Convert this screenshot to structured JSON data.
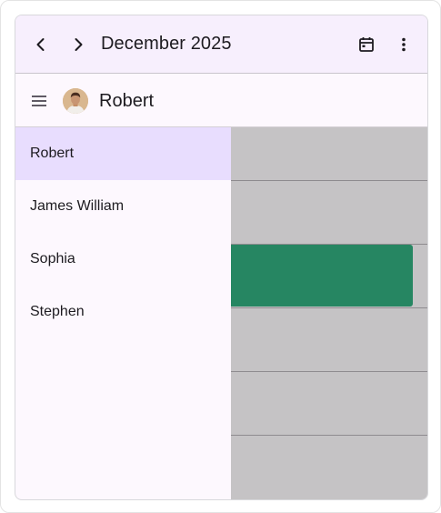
{
  "header": {
    "title": "December 2025",
    "prev_icon": "chevron-left-icon",
    "next_icon": "chevron-right-icon",
    "calendar_icon": "calendar-icon",
    "more_icon": "more-vert-icon"
  },
  "resource_bar": {
    "menu_icon": "menu-icon",
    "selected_resource": "Robert"
  },
  "drawer": {
    "items": [
      {
        "label": "Robert",
        "selected": true
      },
      {
        "label": "James William",
        "selected": false
      },
      {
        "label": "Sophia",
        "selected": false
      },
      {
        "label": "Stephen",
        "selected": false
      }
    ]
  },
  "colors": {
    "header_bg": "#f7effd",
    "selected_item_bg": "#e8ddfe",
    "appointment": "#268662",
    "timeline_bg": "#c5c3c5"
  }
}
